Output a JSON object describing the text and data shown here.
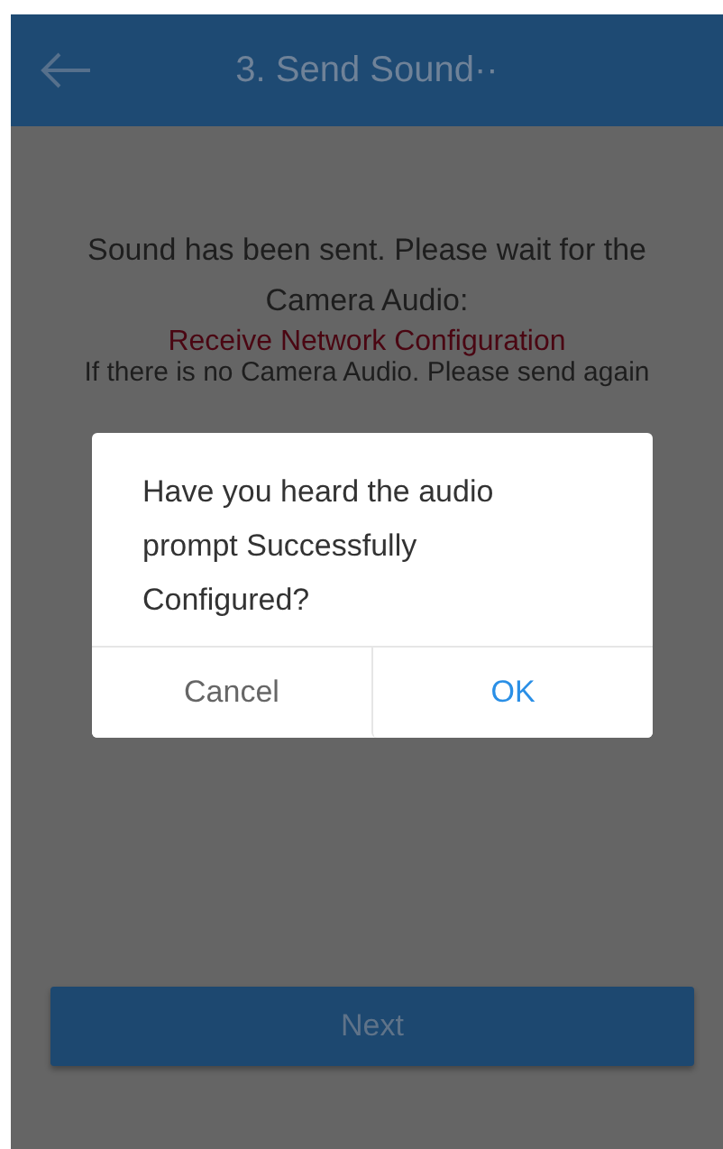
{
  "header": {
    "title": "3. Send Sound··"
  },
  "message": {
    "lines": [
      "Sound has been sent. Please wait for the Camera Audio:"
    ],
    "highlight": "Receive Network Configuration",
    "hint": "If there is no Camera Audio. Please send again"
  },
  "dialog": {
    "text": "Have you heard the audio prompt Successfully Configured?",
    "buttons": [
      {
        "label": "Cancel",
        "kind": "cancel"
      },
      {
        "label": "OK",
        "kind": "confirm"
      }
    ]
  },
  "next_button": {
    "label": "Next"
  }
}
